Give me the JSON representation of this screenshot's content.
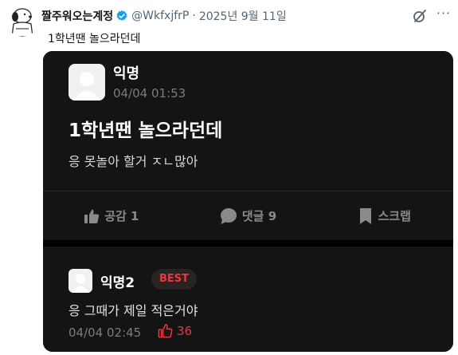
{
  "tweet": {
    "display_name": "짤주워오는계정",
    "handle": "@WkfxjfrP",
    "separator": "·",
    "date": "2025년 9월 11일",
    "text": "1학년땐 놀으라던데",
    "more_label": "···"
  },
  "post": {
    "author": "익명",
    "time": "04/04 01:53",
    "title": "1학년땐 놀으라던데",
    "body": "응 못놀아 할거 ㅈㄴ많아",
    "actions": [
      {
        "label": "공감 1",
        "icon": "thumbs-up-icon"
      },
      {
        "label": "댓글 9",
        "icon": "comment-bubble-icon"
      },
      {
        "label": "스크랩",
        "icon": "bookmark-icon"
      }
    ]
  },
  "comment": {
    "author": "익명2",
    "badge": "BEST",
    "body": "응 그때가 제일 적은거야",
    "time": "04/04 02:45",
    "likes": "36"
  },
  "colors": {
    "card_bg": "#141414",
    "accent_red": "#f0343c",
    "verified_blue": "#1d9bf0"
  }
}
